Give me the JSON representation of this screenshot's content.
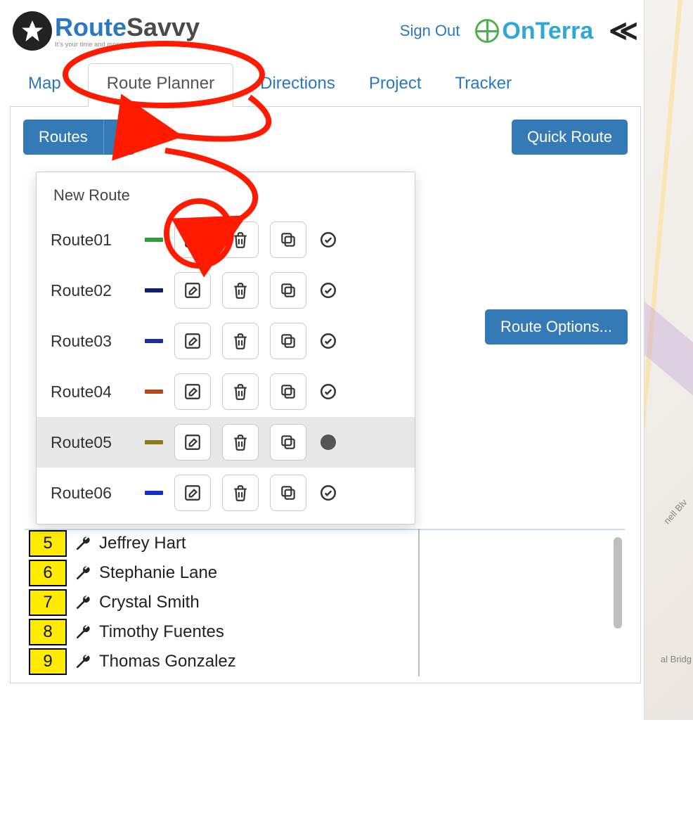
{
  "brand": {
    "name_part1": "Route",
    "name_part2": "Savvy",
    "tagline": "It's your time and money. Make the most of it."
  },
  "header": {
    "sign_out": "Sign Out",
    "partner_brand": "OnTerra"
  },
  "tabs": {
    "map": "Map",
    "route_planner": "Route Planner",
    "directions": "Directions",
    "project": "Project",
    "tracker": "Tracker"
  },
  "buttons": {
    "routes": "Routes",
    "quick_route": "Quick Route",
    "route_options": "Route Options..."
  },
  "routes_menu": {
    "new_route": "New Route",
    "items": [
      {
        "name": "Route01",
        "color": "#2e9e3a",
        "selected": false
      },
      {
        "name": "Route02",
        "color": "#12206b",
        "selected": false
      },
      {
        "name": "Route03",
        "color": "#1a2f9c",
        "selected": false
      },
      {
        "name": "Route04",
        "color": "#b04a1e",
        "selected": false
      },
      {
        "name": "Route05",
        "color": "#8a7a1a",
        "selected": true
      },
      {
        "name": "Route06",
        "color": "#1030c8",
        "selected": false
      }
    ]
  },
  "stops": [
    {
      "num": "5",
      "name": "Jeffrey Hart"
    },
    {
      "num": "6",
      "name": "Stephanie Lane"
    },
    {
      "num": "7",
      "name": "Crystal Smith"
    },
    {
      "num": "8",
      "name": "Timothy Fuentes"
    },
    {
      "num": "9",
      "name": "Thomas Gonzalez"
    }
  ],
  "map_labels": {
    "l1": "nell Blv",
    "l2": "al Bridg"
  }
}
